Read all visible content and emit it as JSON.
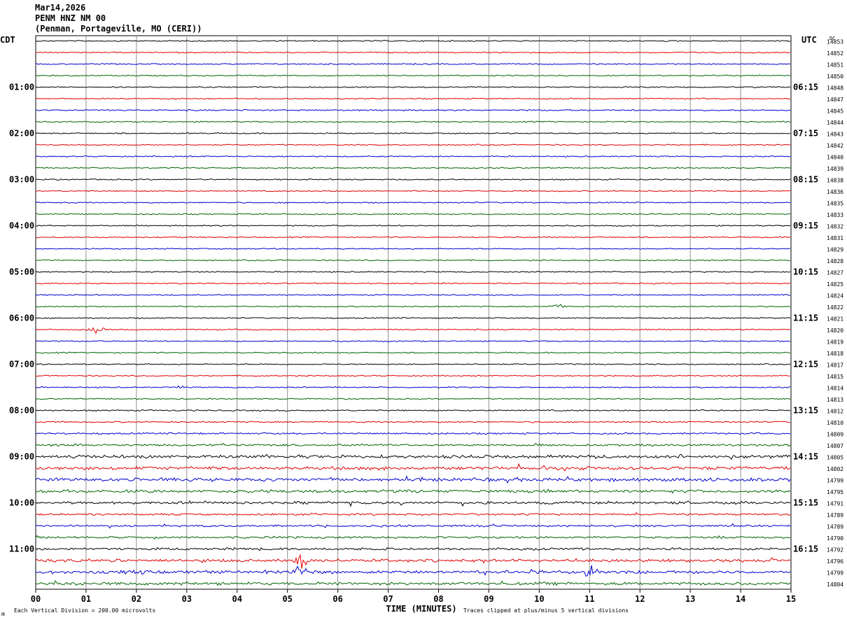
{
  "header": {
    "date": "Mar14,2026",
    "channel": "PENM HNZ NM 00",
    "station": "(Penman, Portageville, MO (CERI))"
  },
  "chart_data": {
    "type": "line",
    "title": "Mar14,2026 PENM HNZ NM 00 (Penman, Portageville, MO (CERI))",
    "left_timezone": "CDT",
    "right_timezone": "UTC",
    "dc_label": "DC",
    "xlabel": "TIME (MINUTES)",
    "x_ticks": [
      "00",
      "01",
      "02",
      "03",
      "04",
      "05",
      "06",
      "07",
      "08",
      "09",
      "10",
      "11",
      "12",
      "13",
      "14",
      "15"
    ],
    "xlim": [
      0,
      15
    ],
    "grid": true,
    "trace_colors": [
      "#000000",
      "#e00000",
      "#0000d0",
      "#006400"
    ],
    "left_time_labels": [
      "01:00",
      "02:00",
      "03:00",
      "04:00",
      "05:00",
      "06:00",
      "07:00",
      "08:00",
      "09:00",
      "10:00",
      "11:00"
    ],
    "right_time_labels": [
      "06:15",
      "07:15",
      "08:15",
      "09:15",
      "10:15",
      "11:15",
      "12:15",
      "13:15",
      "14:15",
      "15:15",
      "16:15"
    ],
    "dc_offsets": [
      14853,
      14852,
      14851,
      14850,
      14848,
      14847,
      14845,
      14844,
      14843,
      14842,
      14840,
      14839,
      14838,
      14836,
      14835,
      14833,
      14832,
      14831,
      14829,
      14828,
      14827,
      14825,
      14824,
      14822,
      14821,
      14820,
      14819,
      14818,
      14817,
      14815,
      14814,
      14813,
      14812,
      14810,
      14809,
      14807,
      14805,
      14802,
      14799,
      14795,
      14791,
      14789,
      14789,
      14790,
      14792,
      14796,
      14799,
      14804
    ],
    "trace_amplitude": [
      1,
      1,
      1,
      1,
      1,
      1,
      1.2,
      1,
      1,
      1,
      1,
      1,
      1,
      1,
      1,
      1,
      1,
      1,
      1,
      1,
      1,
      1,
      1,
      1,
      1,
      1,
      1,
      1,
      1,
      1,
      1,
      1,
      1.2,
      1.2,
      1.4,
      1.8,
      2.6,
      2.8,
      2.8,
      2.4,
      2.2,
      1.6,
      1.6,
      1.8,
      2,
      2.4,
      2.6,
      2.4
    ],
    "events": [
      {
        "trace": 23,
        "minute": 10.35,
        "amplitude": 5
      },
      {
        "trace": 25,
        "minute": 1.2,
        "amplitude": 6
      },
      {
        "trace": 30,
        "minute": 2.85,
        "amplitude": 3
      },
      {
        "trace": 45,
        "minute": 5.25,
        "amplitude": 8
      },
      {
        "trace": 46,
        "minute": 5.25,
        "amplitude": 6
      },
      {
        "trace": 46,
        "minute": 11.05,
        "amplitude": 5
      }
    ],
    "footnote_scale": "Each Vertical Division =  200.00 microvolts",
    "footnote_clip": "Traces clipped at plus/minus 5 vertical divisions",
    "footnote_mark": "m"
  }
}
